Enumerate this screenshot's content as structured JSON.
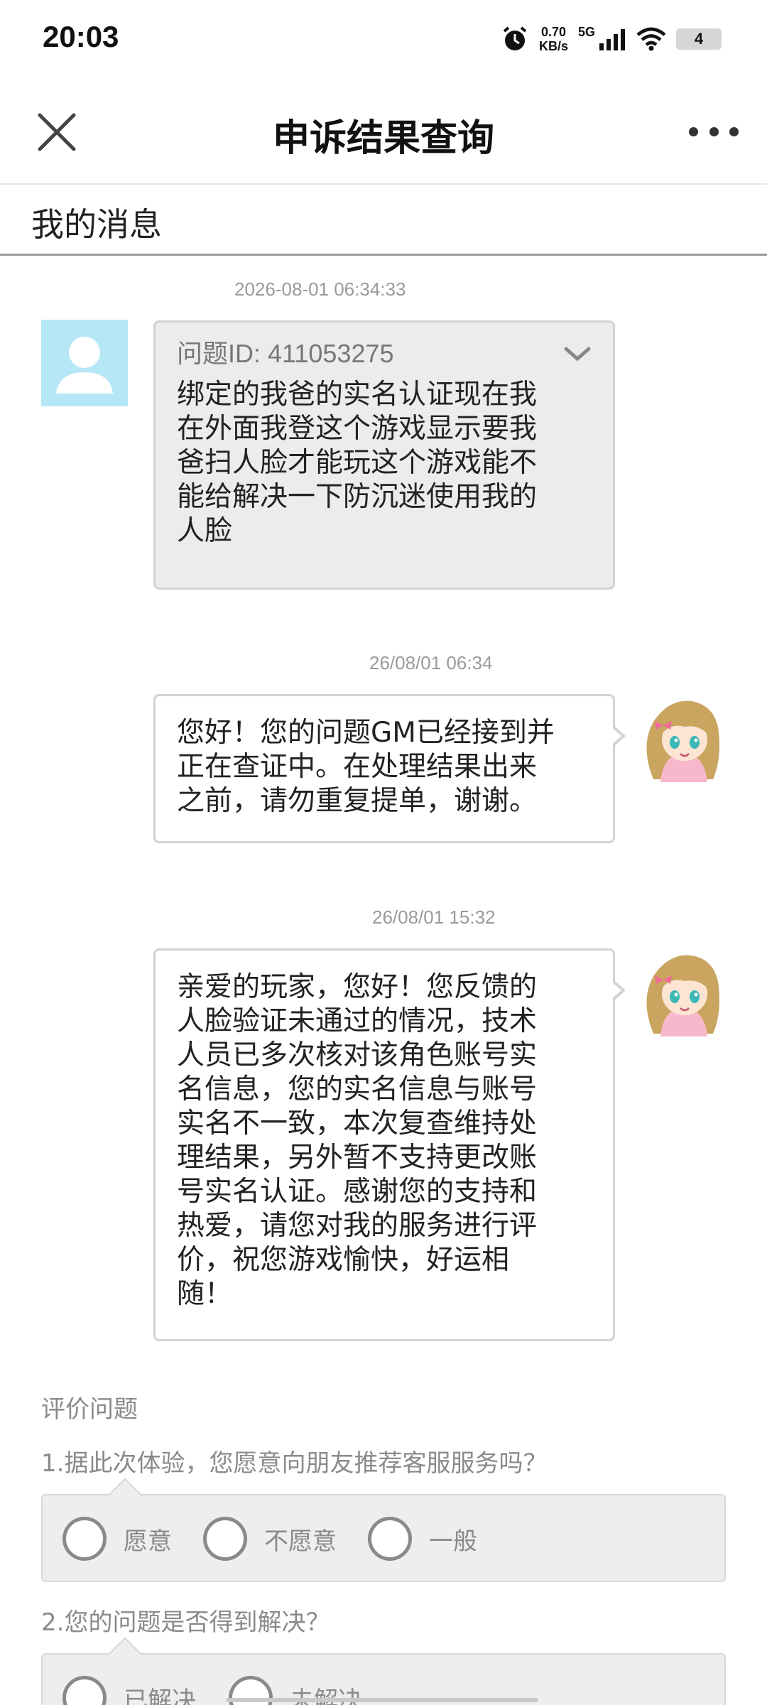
{
  "status_bar": {
    "time": "20:03",
    "net_speed_value": "0.70",
    "net_speed_unit": "KB/s",
    "network_type": "5G",
    "battery": "4",
    "icons": [
      "alarm-icon",
      "signal-icon",
      "wifi-icon",
      "battery-icon"
    ]
  },
  "header": {
    "title": "申诉结果查询",
    "close_icon": "close-icon",
    "more_icon": "more-icon"
  },
  "section": {
    "title": "我的消息"
  },
  "messages": [
    {
      "timestamp": "2026-08-01 06:34:33",
      "sender": "user",
      "question_id_label": "问题ID: 411053275",
      "lines": [
        "绑定的我爸的实名认证现在我",
        "在外面我登这个游戏显示要我",
        "爸扫人脸才能玩这个游戏能不",
        "能给解决一下防沉迷使用我的",
        "人脸"
      ]
    },
    {
      "timestamp": "26/08/01 06:34",
      "sender": "gm",
      "lines": [
        "您好！您的问题GM已经接到并",
        "正在查证中。在处理结果出来",
        "之前，请勿重复提单，谢谢。"
      ]
    },
    {
      "timestamp": "26/08/01 15:32",
      "sender": "gm",
      "lines": [
        "亲爱的玩家，您好！您反馈的",
        "人脸验证未通过的情况，技术",
        "人员已多次核对该角色账号实",
        "名信息，您的实名信息与账号",
        "实名不一致，本次复查维持处",
        "理结果，另外暂不支持更改账",
        "号实名认证。感谢您的支持和",
        "热爱，请您对我的服务进行评",
        "价，祝您游戏愉快，好运相",
        "随！"
      ]
    }
  ],
  "rating": {
    "title": "评价问题",
    "questions": [
      {
        "text": "1.据此次体验，您愿意向朋友推荐客服服务吗？",
        "options": [
          "愿意",
          "不愿意",
          "一般"
        ]
      },
      {
        "text": "2.您的问题是否得到解决？",
        "options": [
          "已解决",
          "未解决"
        ]
      }
    ]
  }
}
